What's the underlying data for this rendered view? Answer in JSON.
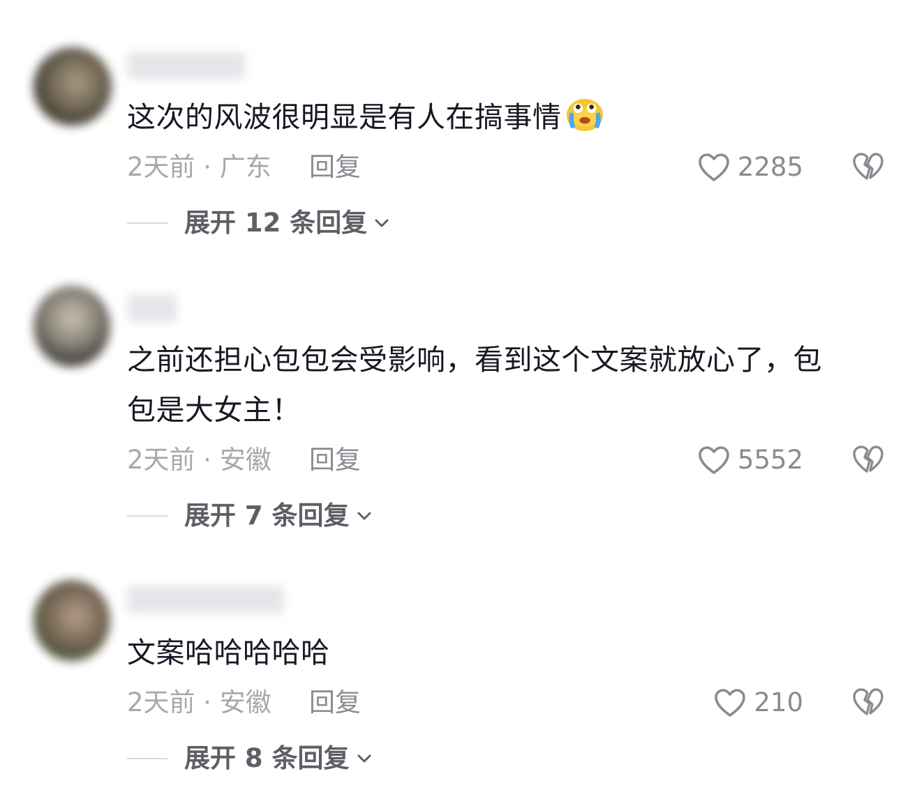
{
  "comments": [
    {
      "text": "这次的风波很明显是有人在搞事情",
      "emoji": "crying-laughing-emoji",
      "meta": "2天前 · 广东",
      "reply_label": "回复",
      "likes": "2285",
      "expand_label": "展开 12 条回复"
    },
    {
      "text_line1": "之前还担心包包会受影响，看到这个文案就放心了，包",
      "text_line2": "包是大女主！",
      "meta": "2天前 · 安徽",
      "reply_label": "回复",
      "likes": "5552",
      "expand_label": "展开 7 条回复"
    },
    {
      "text": "文案哈哈哈哈哈",
      "meta": "2天前 · 安徽",
      "reply_label": "回复",
      "likes": "210",
      "expand_label": "展开 8 条回复"
    }
  ],
  "icons": {
    "like": "heart-outline-icon",
    "dislike": "broken-heart-icon",
    "expand": "chevron-down-icon"
  },
  "colors": {
    "text_primary": "#161823",
    "text_secondary": "#a8a8ab",
    "icon_gray": "#8a8b91"
  }
}
